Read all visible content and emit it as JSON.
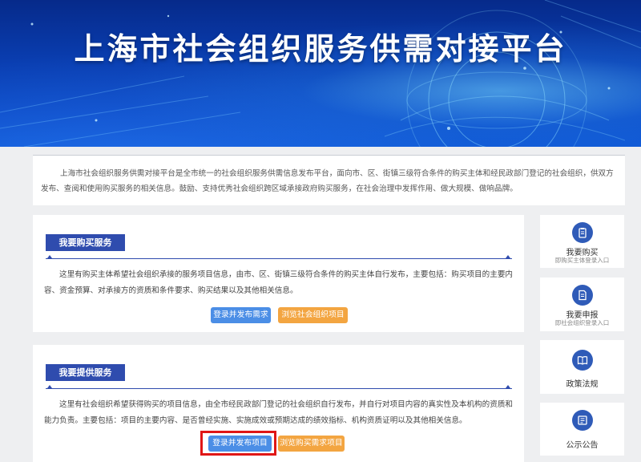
{
  "banner": {
    "title": "上海市社会组织服务供需对接平台"
  },
  "intro": {
    "text": "上海市社会组织服务供需对接平台是全市统一的社会组织服务供需信息发布平台，面向市、区、街镇三级符合条件的购买主体和经民政部门登记的社会组织，供双方发布、查阅和使用购买服务的相关信息。鼓励、支持优秀社会组织跨区域承接政府购买服务，在社会治理中发挥作用、做大规模、做响品牌。"
  },
  "buy_section": {
    "label": "我要购买服务",
    "description": "这里有购买主体希望社会组织承接的服务项目信息，由市、区、街镇三级符合条件的购买主体自行发布，主要包括：购买项目的主要内容、资金预算、对承接方的资质和条件要求、购买结果以及其他相关信息。",
    "primary_button": "登录并发布需求",
    "secondary_button": "浏览社会组织项目"
  },
  "provide_section": {
    "label": "我要提供服务",
    "description": "这里有社会组织希望获得购买的项目信息，由全市经民政部门登记的社会组织自行发布，并自行对项目内容的真实性及本机构的资质和能力负责。主要包括：项目的主要内容、是否曾经实施、实施成效或预期达成的绩效指标、机构资质证明以及其他相关信息。",
    "primary_button": "登录并发布项目",
    "secondary_button": "浏览购买需求项目"
  },
  "sidebar": [
    {
      "title": "我要购买",
      "subtitle": "即购买主体登录入口",
      "icon": "clipboard-icon"
    },
    {
      "title": "我要申报",
      "subtitle": "即社会组织登录入口",
      "icon": "document-icon"
    },
    {
      "title": "政策法规",
      "subtitle": "",
      "icon": "book-icon"
    },
    {
      "title": "公示公告",
      "subtitle": "",
      "icon": "notice-icon"
    }
  ],
  "colors": {
    "accent": "#2f4cae",
    "button_blue": "#4b8ee6",
    "button_orange": "#f3a541",
    "highlight": "#e01616"
  }
}
